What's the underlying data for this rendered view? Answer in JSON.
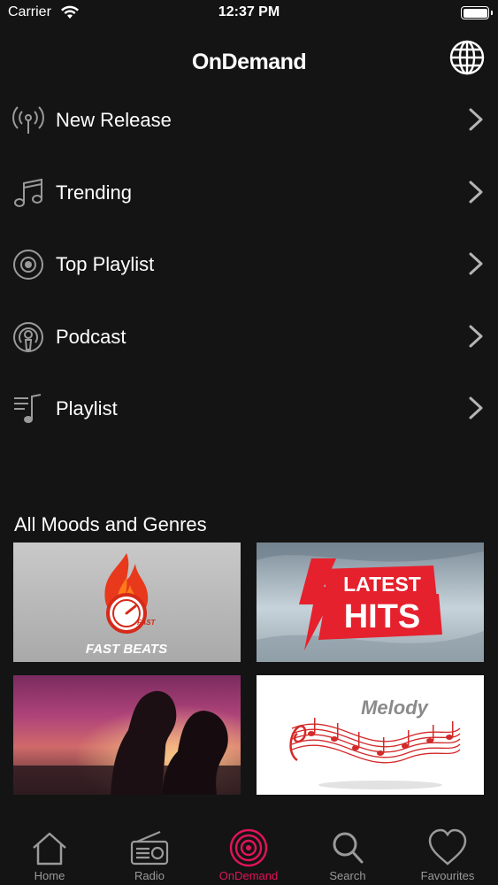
{
  "status_bar": {
    "carrier": "Carrier",
    "time": "12:37 PM"
  },
  "header": {
    "title": "OnDemand",
    "globe_icon": "globe-icon"
  },
  "menu": {
    "items": [
      {
        "label": "New Release",
        "icon": "broadcast-icon"
      },
      {
        "label": "Trending",
        "icon": "music-note-icon"
      },
      {
        "label": "Top Playlist",
        "icon": "disc-icon"
      },
      {
        "label": "Podcast",
        "icon": "podcast-icon"
      },
      {
        "label": "Playlist",
        "icon": "playlist-icon"
      }
    ]
  },
  "genres": {
    "title": "All Moods and Genres",
    "tiles": [
      {
        "name": "fast-beats",
        "text": "FAST BEATS",
        "badge": "FAST"
      },
      {
        "name": "latest-hits",
        "line1": "LATEST",
        "line2": "HITS"
      },
      {
        "name": "romance",
        "text": ""
      },
      {
        "name": "melody",
        "text": "Melody"
      }
    ]
  },
  "tab_bar": {
    "items": [
      {
        "label": "Home",
        "icon": "home-icon",
        "active": false
      },
      {
        "label": "Radio",
        "icon": "radio-icon",
        "active": false
      },
      {
        "label": "OnDemand",
        "icon": "vinyl-icon",
        "active": true
      },
      {
        "label": "Search",
        "icon": "search-icon",
        "active": false
      },
      {
        "label": "Favourites",
        "icon": "heart-icon",
        "active": false
      }
    ]
  },
  "colors": {
    "background": "#141414",
    "accent": "#e0145a",
    "inactive": "#9a9a9a",
    "text": "#ffffff"
  }
}
